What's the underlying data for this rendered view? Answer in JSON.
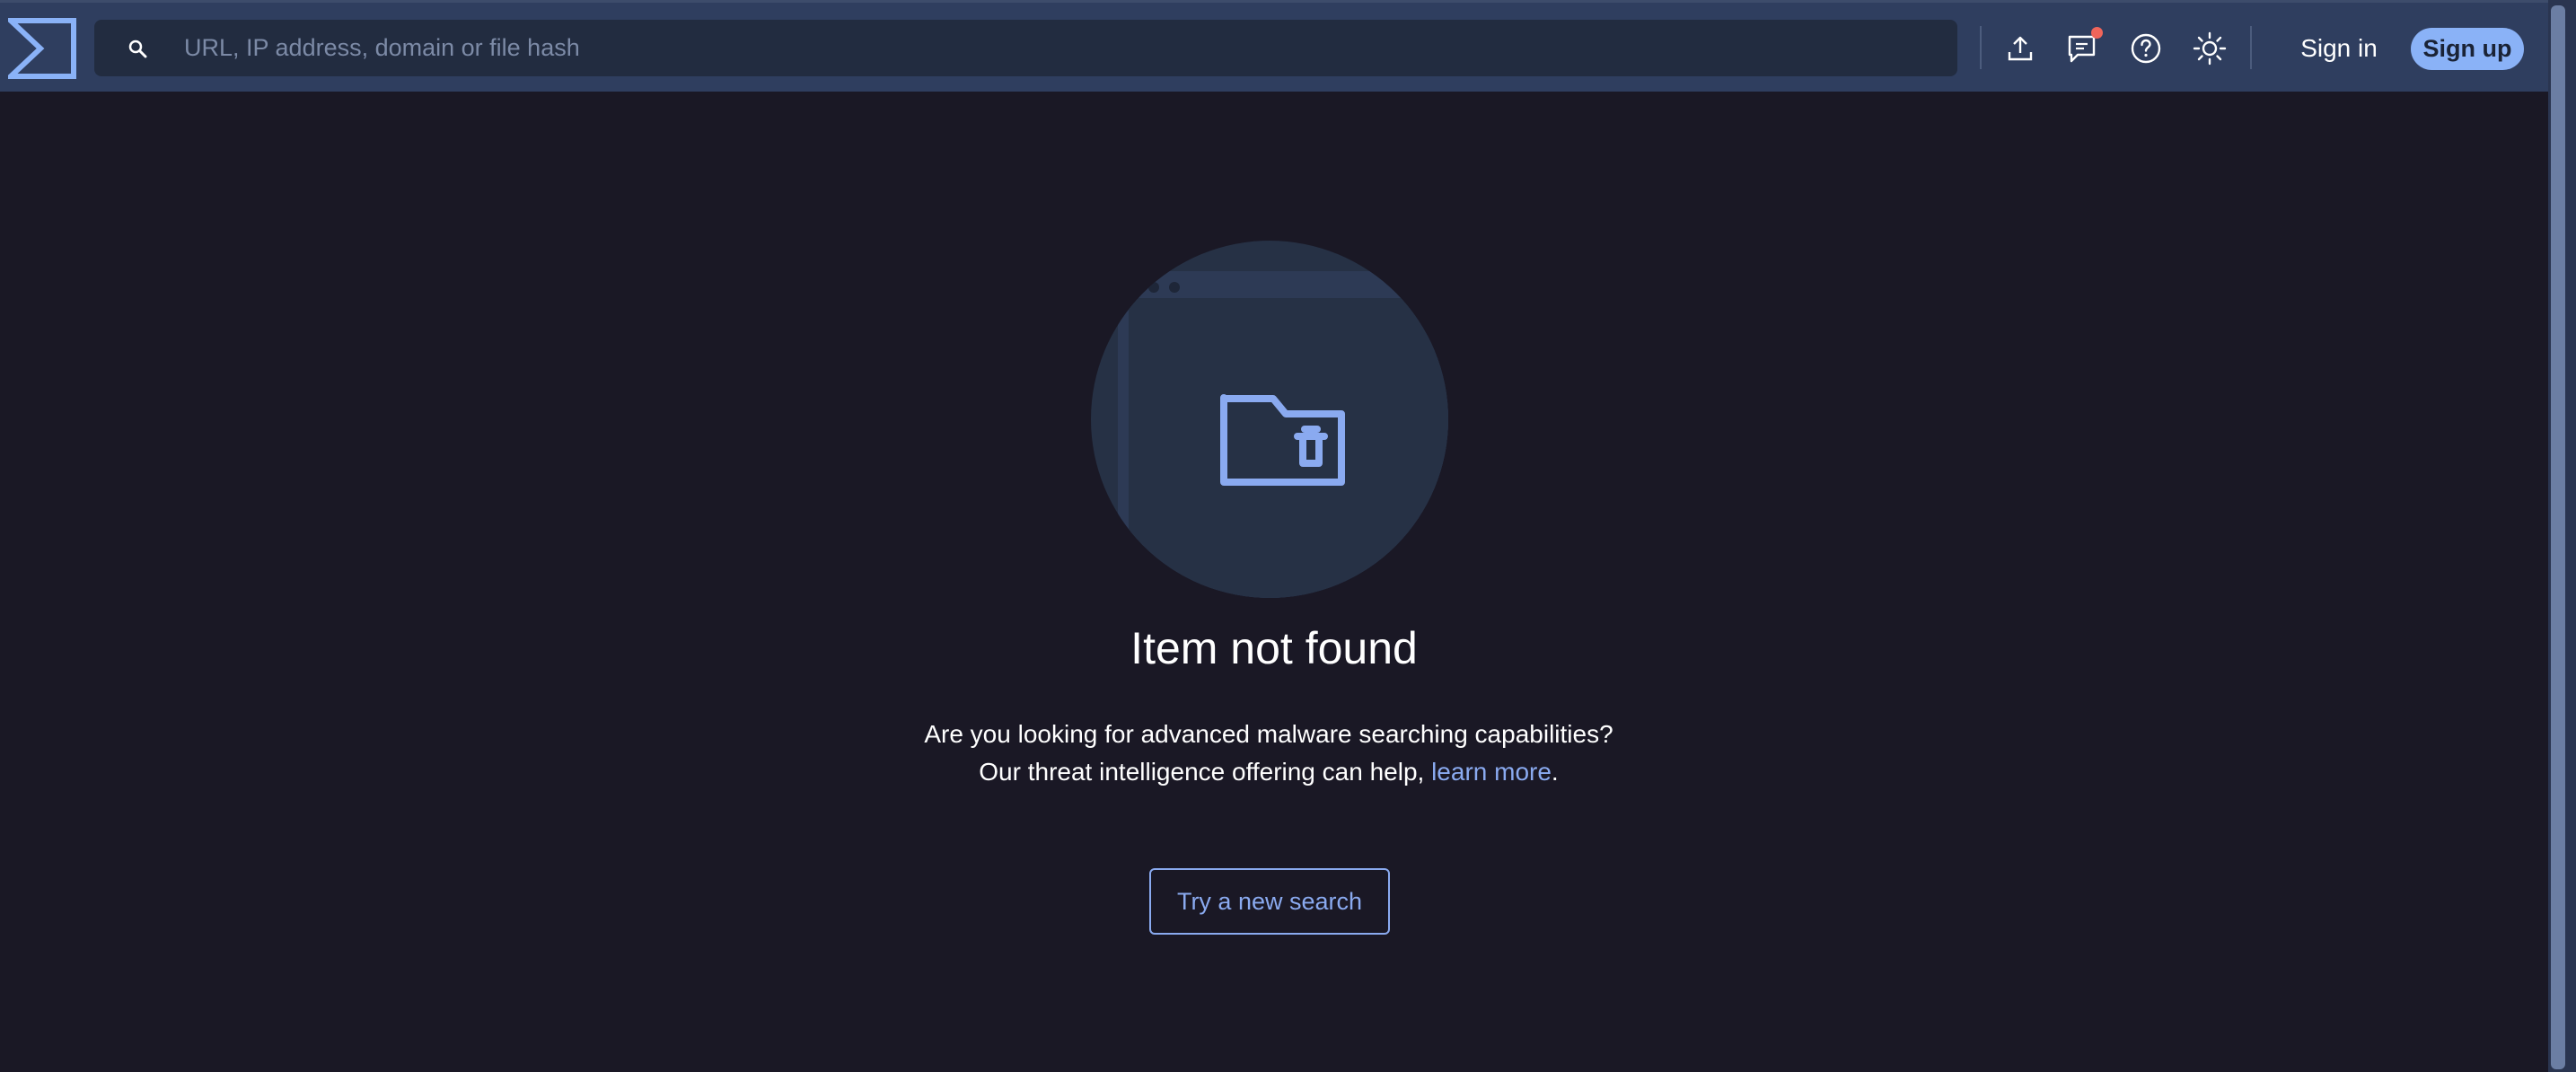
{
  "header": {
    "logo": "virustotal-sigma-logo",
    "search": {
      "placeholder": "URL, IP address, domain or file hash",
      "value": ""
    },
    "icons": {
      "upload": "upload-icon",
      "chat": "chat-icon",
      "help": "help-icon",
      "theme": "sun-icon"
    },
    "chat_has_notification": true,
    "sign_in_label": "Sign in",
    "sign_up_label": "Sign up"
  },
  "main": {
    "illustration_icon": "folder-trash-icon",
    "title": "Item not found",
    "message_line1": "Are you looking for advanced malware searching capabilities?",
    "message_line2_prefix": "Our threat intelligence offering can help, ",
    "learn_more_label": "learn more",
    "message_line2_suffix": ".",
    "try_button_label": "Try a new search"
  },
  "colors": {
    "background": "#1a1825",
    "topbar": "#2f3e5f",
    "search_bg": "#222c40",
    "accent": "#8ab2f7",
    "link": "#8aaaf0",
    "notification": "#f0655a",
    "illustration_circle": "#263145"
  }
}
